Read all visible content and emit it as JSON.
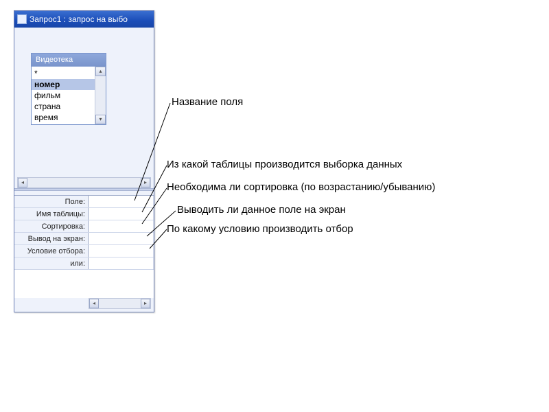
{
  "window": {
    "title": "Запрос1 : запрос на выбо"
  },
  "table": {
    "title": "Видеотека",
    "fields": [
      "*",
      "номер",
      "фильм",
      "страна",
      "время"
    ],
    "selected_index": 1
  },
  "grid_labels": {
    "field": "Поле:",
    "table": "Имя таблицы:",
    "sort": "Сортировка:",
    "show": "Вывод на экран:",
    "criteria": "Условие отбора:",
    "or": "или:"
  },
  "annotations": {
    "field_name": "Название поля",
    "from_table": "Из какой таблицы производится выборка данных",
    "sort_needed": "Необходима ли сортировка (по возрастанию/убыванию)",
    "show_field": "Выводить ли данное поле на экран",
    "criteria_note": "По какому условию производить отбор"
  }
}
